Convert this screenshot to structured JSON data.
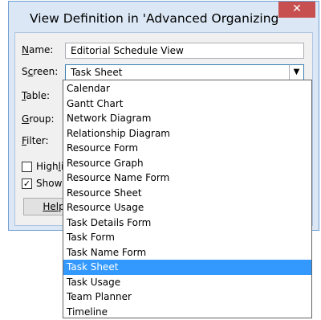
{
  "dialog": {
    "title": "View Definition in 'Advanced Organizing'",
    "close_glyph": "✕"
  },
  "form": {
    "name_label_key": "N",
    "name_label_rest": "ame:",
    "name_value": "Editorial Schedule View",
    "screen_label_pre": "S",
    "screen_label_key": "c",
    "screen_label_rest": "reen:",
    "screen_value": "Task Sheet",
    "screen_arrow_glyph": "▼",
    "table_label_key": "T",
    "table_label_rest": "able:",
    "group_label_key": "G",
    "group_label_rest": "roup:",
    "filter_label_key": "F",
    "filter_label_rest": "ilter:",
    "highlight_label_pre": "High",
    "highlight_label_key": "l",
    "highlight_label_rest": "i",
    "highlight_checked": false,
    "show_label": "Show",
    "show_checked": true,
    "check_glyph": "✓",
    "help_label_key": "Hel",
    "help_label_rest": "p"
  },
  "dropdown": {
    "selected": "Task Sheet",
    "options": [
      "Calendar",
      "Gantt Chart",
      "Network Diagram",
      "Relationship Diagram",
      "Resource Form",
      "Resource Graph",
      "Resource Name Form",
      "Resource Sheet",
      "Resource Usage",
      "Task Details Form",
      "Task Form",
      "Task Name Form",
      "Task Sheet",
      "Task Usage",
      "Team Planner",
      "Timeline"
    ]
  },
  "colors": {
    "frame": "#dbe7f5",
    "close_button": "#c74f50",
    "selection": "#3399ff"
  }
}
